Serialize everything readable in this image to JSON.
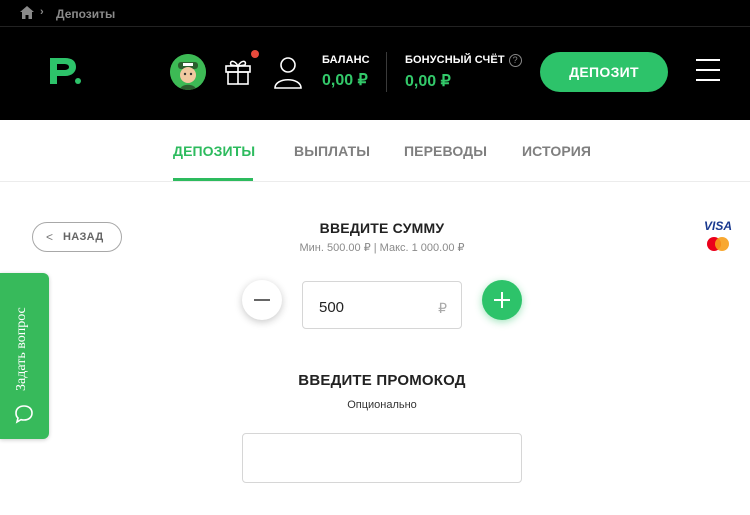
{
  "breadcrumb": {
    "current": "Депозиты"
  },
  "header": {
    "balance_label": "БАЛАНС",
    "balance_value": "0,00 ₽",
    "bonus_label": "БОНУСНЫЙ СЧЁТ",
    "bonus_help": "?",
    "bonus_value": "0,00 ₽",
    "deposit_button": "ДЕПОЗИТ"
  },
  "tabs": [
    {
      "label": "ДЕПОЗИТЫ",
      "active": true
    },
    {
      "label": "ВЫПЛАТЫ",
      "active": false
    },
    {
      "label": "ПЕРЕВОДЫ",
      "active": false
    },
    {
      "label": "ИСТОРИЯ",
      "active": false
    }
  ],
  "back_button": "НАЗАД",
  "amount": {
    "title": "ВВЕДИТЕ СУММУ",
    "limits": "Мин. 500.00 ₽ | Макс. 1 000.00 ₽",
    "value": "500",
    "currency": "₽"
  },
  "payment": {
    "visa": "VISA"
  },
  "promo": {
    "title": "ВВЕДИТЕ ПРОМОКОД",
    "subtitle": "Опционально",
    "value": ""
  },
  "support_tab": {
    "label": "Задать вопрос"
  },
  "colors": {
    "accent": "#2dc36a",
    "header_bg": "#000000",
    "notification": "#e84a3c"
  },
  "icons": [
    "home-icon",
    "chevron-right-icon",
    "logo-icon",
    "avatar-icon",
    "gift-icon",
    "user-icon",
    "help-icon",
    "menu-icon",
    "chevron-left-icon",
    "minus-icon",
    "plus-icon",
    "mastercard-icon",
    "chat-icon"
  ]
}
